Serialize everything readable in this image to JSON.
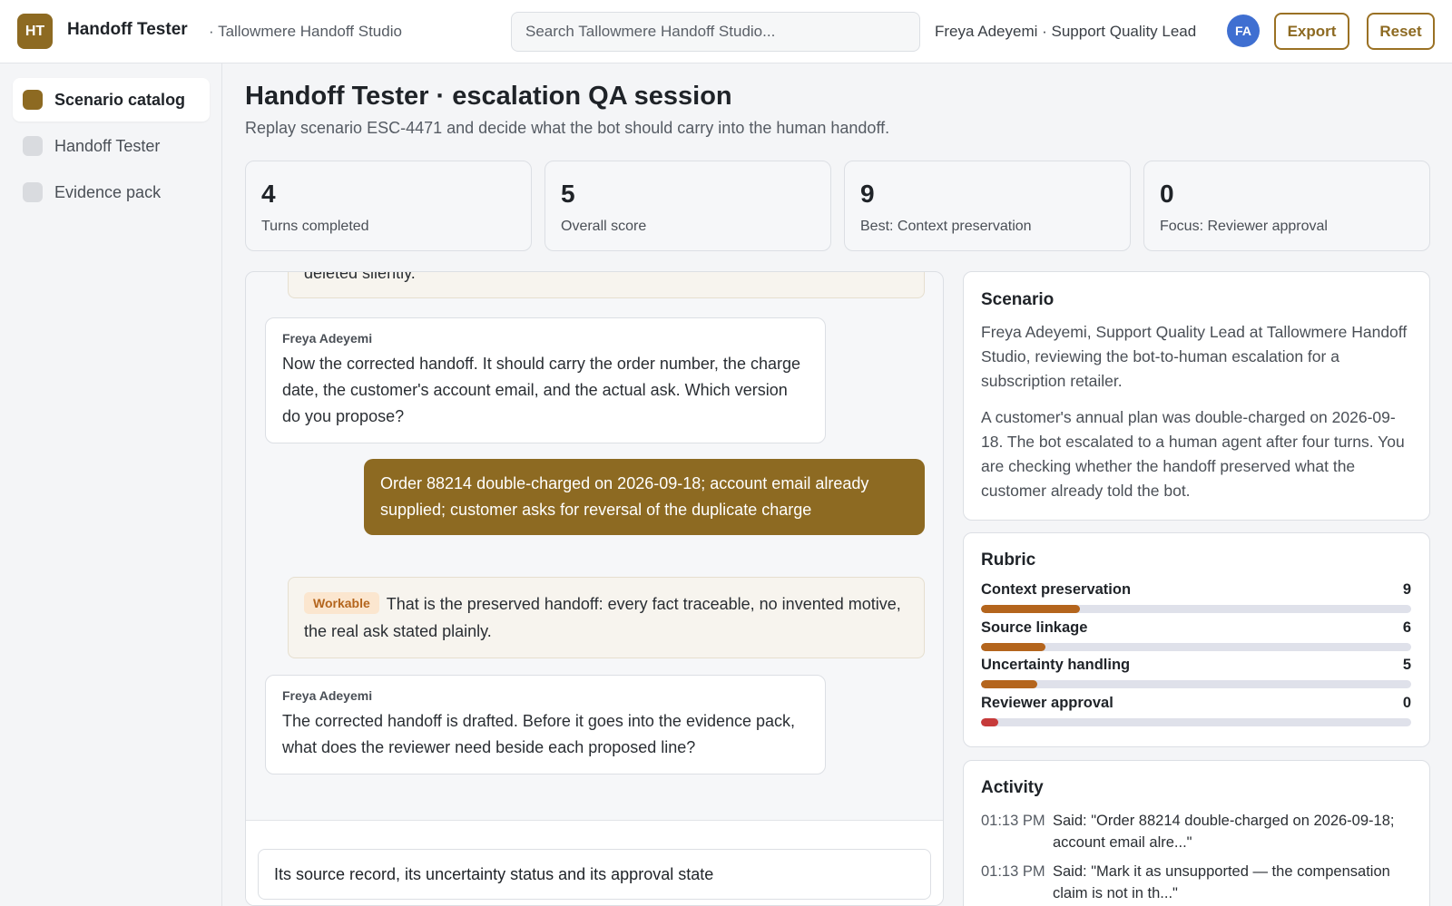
{
  "header": {
    "logo_initials": "HT",
    "app_title": "Handoff Tester",
    "workspace": "· Tallowmere Handoff Studio",
    "search_placeholder": "Search Tallowmere Handoff Studio...",
    "user_label": "Freya Adeyemi · Support Quality Lead",
    "avatar_initials": "FA",
    "export_label": "Export",
    "reset_label": "Reset"
  },
  "sidebar": {
    "items": [
      {
        "label": "Scenario catalog",
        "active": true
      },
      {
        "label": "Handoff Tester",
        "active": false
      },
      {
        "label": "Evidence pack",
        "active": false
      }
    ]
  },
  "main": {
    "title": "Handoff Tester · escalation QA session",
    "subtitle": "Replay scenario ESC-4471 and decide what the bot should carry into the human handoff."
  },
  "stats": [
    {
      "value": "4",
      "label": "Turns completed"
    },
    {
      "value": "5",
      "label": "Overall score"
    },
    {
      "value": "9",
      "label": "Best: Context preservation"
    },
    {
      "value": "0",
      "label": "Focus: Reviewer approval"
    }
  ],
  "chat": {
    "messages": [
      {
        "kind": "system",
        "text": "deleted silently."
      },
      {
        "kind": "user",
        "author": "Freya Adeyemi",
        "text": "Now the corrected handoff. It should carry the order number, the charge date, the customer's account email, and the actual ask. Which version do you propose?"
      },
      {
        "kind": "bot",
        "text": "Order 88214 double-charged on 2026-09-18; account email already supplied; customer asks for reversal of the duplicate charge"
      },
      {
        "kind": "system",
        "badge": "Workable",
        "text": "That is the preserved handoff: every fact traceable, no invented motive, the real ask stated plainly."
      },
      {
        "kind": "user",
        "author": "Freya Adeyemi",
        "text": "The corrected handoff is drafted. Before it goes into the evidence pack, what does the reviewer need beside each proposed line?"
      }
    ],
    "composer_value": "Its source record, its uncertainty status and its approval state"
  },
  "scenario": {
    "title": "Scenario",
    "paragraphs": [
      "Freya Adeyemi, Support Quality Lead at Tallowmere Handoff Studio, reviewing the bot-to-human escalation for a subscription retailer.",
      "A customer's annual plan was double-charged on 2026-09-18. The bot escalated to a human agent after four turns. You are checking whether the handoff preserved what the customer already told the bot."
    ]
  },
  "rubric": {
    "title": "Rubric",
    "max_score": 10,
    "items": [
      {
        "label": "Context preservation",
        "score": "9",
        "fill_fraction": 0.23
      },
      {
        "label": "Source linkage",
        "score": "6",
        "fill_fraction": 0.15
      },
      {
        "label": "Uncertainty handling",
        "score": "5",
        "fill_fraction": 0.13
      },
      {
        "label": "Reviewer approval",
        "score": "0",
        "fill_fraction": 0.04
      }
    ]
  },
  "activity": {
    "title": "Activity",
    "items": [
      {
        "time": "01:13 PM",
        "text": "Said: \"Order 88214 double-charged on 2026-09-18; account email alre...\""
      },
      {
        "time": "01:13 PM",
        "text": "Said: \"Mark it as unsupported — the compensation claim is not in th...\""
      }
    ]
  },
  "colors": {
    "brand": "#8d6a22",
    "rubric_fill": "#b4651d",
    "rubric_low": "#c63a3a",
    "avatar": "#3f6fd1",
    "badge_bg": "#fbe6cf"
  }
}
